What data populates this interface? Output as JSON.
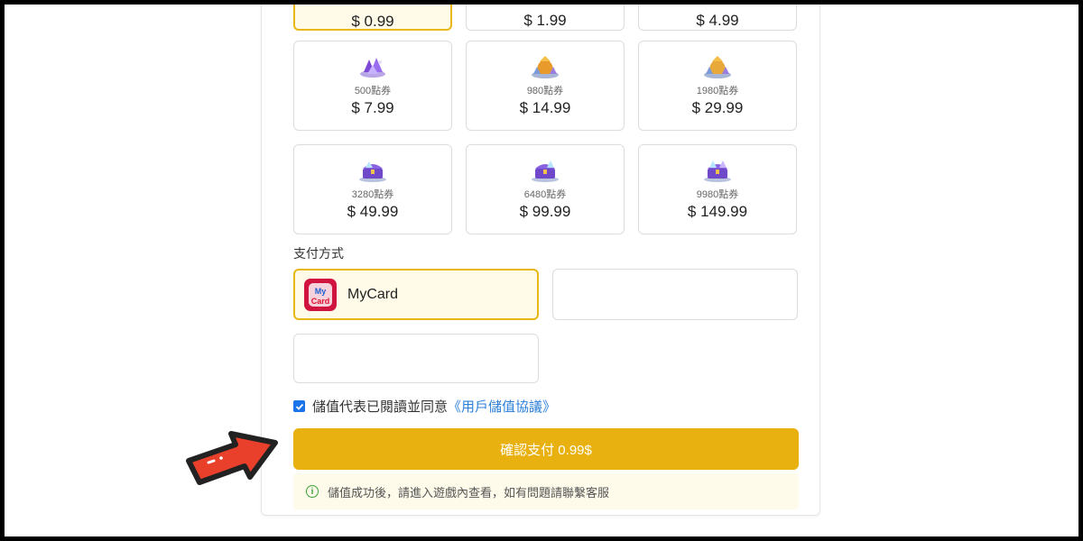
{
  "packages": [
    {
      "points": "",
      "price": "$ 0.99",
      "icon": "gem-small-icon",
      "selected": true
    },
    {
      "points": "",
      "price": "$ 1.99",
      "icon": "gem-small-icon",
      "selected": false
    },
    {
      "points": "",
      "price": "$ 4.99",
      "icon": "gem-small-icon",
      "selected": false
    },
    {
      "points": "500點券",
      "price": "$ 7.99",
      "icon": "gem-pile-icon",
      "selected": false
    },
    {
      "points": "980點券",
      "price": "$ 14.99",
      "icon": "gem-sack-icon",
      "selected": false
    },
    {
      "points": "1980點券",
      "price": "$ 29.99",
      "icon": "gem-sack-icon",
      "selected": false
    },
    {
      "points": "3280點券",
      "price": "$ 49.99",
      "icon": "treasure-chest-icon",
      "selected": false
    },
    {
      "points": "6480點券",
      "price": "$ 99.99",
      "icon": "treasure-chest-icon",
      "selected": false
    },
    {
      "points": "9980點券",
      "price": "$ 149.99",
      "icon": "treasure-chest-icon",
      "selected": false
    }
  ],
  "payment": {
    "section_title": "支付方式",
    "methods": [
      {
        "name": "MyCard",
        "logo_text": "My Card",
        "selected": true
      },
      {
        "name": "",
        "selected": false
      },
      {
        "name": "",
        "selected": false
      }
    ]
  },
  "agreement": {
    "checked": true,
    "text": "儲值代表已閱讀並同意",
    "link": "《用戶儲值協議》"
  },
  "confirm_button": "確認支付 0.99$",
  "notice": "儲值成功後，請進入遊戲內查看，如有問題請聯繫客服",
  "colors": {
    "accent": "#e9b10f",
    "selected_bg": "#fffbe8",
    "link": "#2b7fd9",
    "annotation_arrow": "#e8402a"
  }
}
